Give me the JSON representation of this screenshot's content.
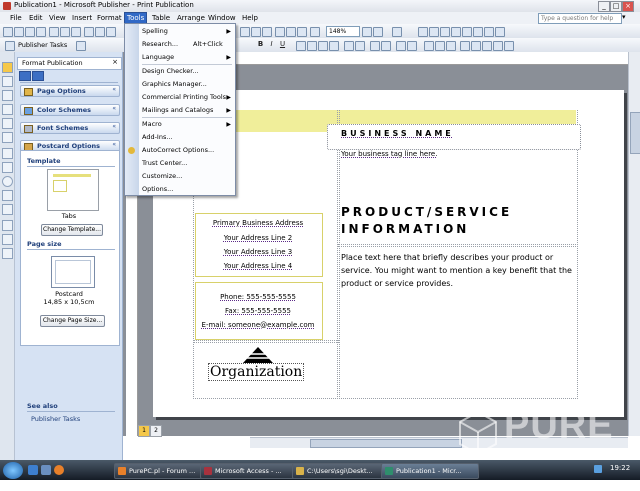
{
  "window": {
    "title": "Publication1 - Microsoft Publisher - Print Publication",
    "controls": [
      "_",
      "□",
      "×"
    ]
  },
  "menubar": {
    "items": [
      "File",
      "Edit",
      "View",
      "Insert",
      "Format",
      "Tools",
      "Table",
      "Arrange",
      "Window",
      "Help"
    ],
    "open_index": 5,
    "help_placeholder": "Type a question for help"
  },
  "toolbar": {
    "zoom": "148%",
    "publisher_tasks": "Publisher Tasks"
  },
  "tools_menu": {
    "items": [
      {
        "label": "Spelling",
        "shortcut": "",
        "submenu": true
      },
      {
        "label": "Research...",
        "shortcut": "Alt+Click",
        "submenu": false
      },
      {
        "label": "Language",
        "shortcut": "",
        "submenu": true
      },
      {
        "label": "Design Checker...",
        "shortcut": "",
        "submenu": false
      },
      {
        "label": "Graphics Manager...",
        "shortcut": "",
        "submenu": false
      },
      {
        "label": "Commercial Printing Tools",
        "shortcut": "",
        "submenu": true
      },
      {
        "label": "Mailings and Catalogs",
        "shortcut": "",
        "submenu": true
      },
      {
        "label": "Macro",
        "shortcut": "",
        "submenu": true
      },
      {
        "label": "Add-Ins...",
        "shortcut": "",
        "submenu": false
      },
      {
        "label": "AutoCorrect Options...",
        "shortcut": "",
        "submenu": false
      },
      {
        "label": "Trust Center...",
        "shortcut": "",
        "submenu": false
      },
      {
        "label": "Customize...",
        "shortcut": "",
        "submenu": false
      },
      {
        "label": "Options...",
        "shortcut": "",
        "submenu": false
      }
    ]
  },
  "task_pane": {
    "title": "Format Publication",
    "sections": [
      "Page Options",
      "Color Schemes",
      "Font Schemes",
      "Postcard Options"
    ],
    "template_label": "Template",
    "template_name": "Tabs",
    "change_template": "Change Template...",
    "page_size_label": "Page size",
    "page_size_name": "Postcard",
    "page_size_dims": "14,85 x 10,5cm",
    "change_page_size": "Change Page Size...",
    "see_also": "See also",
    "see_also_link": "Publisher Tasks"
  },
  "postcard": {
    "business_name": "BUSINESS NAME",
    "tagline": "Your business tag line here.",
    "heading_line1": "PRODUCT/SERVICE",
    "heading_line2": "INFORMATION",
    "body": "Place text here that briefly describes your product or service. You might want to mention a key benefit that the product or service provides.",
    "address": [
      "Primary Business Address",
      "Your Address Line 2",
      "Your Address Line 3",
      "Your Address Line 4"
    ],
    "phone": "Phone: 555-555-5555",
    "fax": "Fax: 555-555-5555",
    "email": "E-mail: someone@example.com",
    "organization": "Organization"
  },
  "page_tabs": [
    "1",
    "2"
  ],
  "taskbar": {
    "tasks": [
      {
        "label": "PurePC.pl - Forum ...",
        "color": "#e8802a"
      },
      {
        "label": "Microsoft Access - ...",
        "color": "#a8323e"
      },
      {
        "label": "C:\\Users\\sgi\\Deskt...",
        "color": "#d8b24a"
      },
      {
        "label": "Publication1 - Micr...",
        "color": "#2f8e6d"
      }
    ],
    "clock": "19:22"
  },
  "watermark": "PURE PC"
}
